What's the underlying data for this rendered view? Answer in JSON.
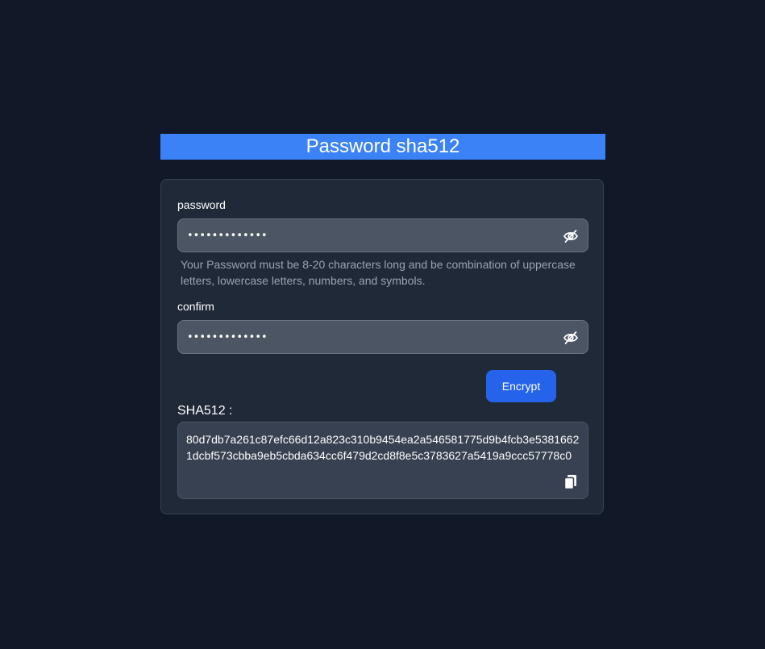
{
  "header": {
    "title": "Password sha512"
  },
  "form": {
    "password": {
      "label": "password",
      "value": "•••••••••••••",
      "toggle_icon": "eye-slash-icon"
    },
    "hint": "Your Password must be 8-20 characters long and be combination of uppercase letters, lowercase letters, numbers, and symbols.",
    "confirm": {
      "label": "confirm",
      "value": "•••••••••••••",
      "toggle_icon": "eye-slash-icon"
    },
    "encrypt_label": "Encrypt"
  },
  "result": {
    "label": "SHA512 :",
    "value": "80d7db7a261c87efc66d12a823c310b9454ea2a546581775d9b4fcb3e53816621dcbf573cbba9eb5cbda634cc6f479d2cd8f8e5c3783627a5419a9ccc57778c0",
    "copy_icon": "copy-icon"
  },
  "colors": {
    "background": "#111827",
    "card": "#1f2937",
    "title_bar": "#3b82f6",
    "button": "#2563eb",
    "input": "#4b5563",
    "result_box": "#374151",
    "hint_text": "#9ca3af"
  }
}
